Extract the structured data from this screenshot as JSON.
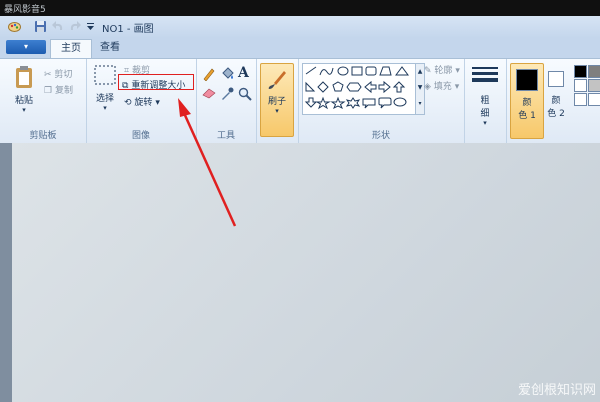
{
  "outer_window": {
    "title": "暴风影音5"
  },
  "window": {
    "doc_title": "NO1 - 画图",
    "app_button_label": "▾"
  },
  "tabs": [
    {
      "label": "主页",
      "active": true
    },
    {
      "label": "查看",
      "active": false
    }
  ],
  "ribbon": {
    "clipboard": {
      "label": "剪贴板",
      "paste": "粘贴",
      "cut": "剪切",
      "copy": "复制"
    },
    "image": {
      "label": "图像",
      "select": "选择",
      "crop": "裁剪",
      "resize": "重新调整大小",
      "rotate": "旋转"
    },
    "tools": {
      "label": "工具"
    },
    "brushes": {
      "label": "刷子"
    },
    "shapes": {
      "label": "形状",
      "outline": "轮廓",
      "fill": "填充"
    },
    "size": {
      "label1": "粗",
      "label2": "细"
    },
    "color1": {
      "label1": "颜",
      "label2": "色 1"
    },
    "color2": {
      "label1": "颜",
      "label2": "色 2"
    }
  },
  "colors": {
    "accent": "#e02020",
    "ribbon_bg": "#dfe9f5",
    "color1": "#000000",
    "color2": "#ffffff"
  },
  "watermark": "爱创根知识网"
}
